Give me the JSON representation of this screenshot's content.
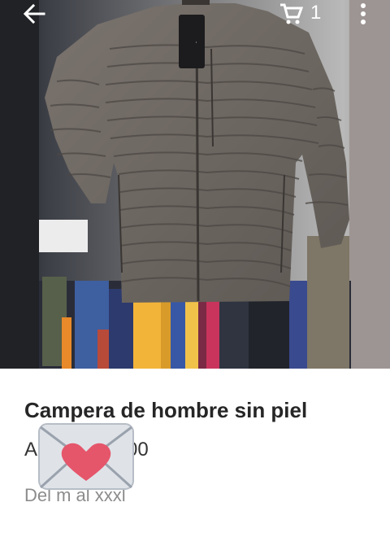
{
  "header": {
    "back_icon": "arrow-left-icon",
    "cart_icon": "shopping-cart-icon",
    "cart_count": "1",
    "more_icon": "more-vertical-icon"
  },
  "product": {
    "image_description": "grey quilted puffer jacket on a rack",
    "title": "Campera de hombre sin piel",
    "price_visible_start": "A",
    "price_visible_end": "00",
    "description": "Del m al xxxl"
  },
  "overlay": {
    "sticker_icon": "envelope-heart-icon"
  },
  "colors": {
    "title": "#262626",
    "description": "#8c8c8c",
    "heart": "#e5566b",
    "envelope": "#dfe3e8"
  }
}
